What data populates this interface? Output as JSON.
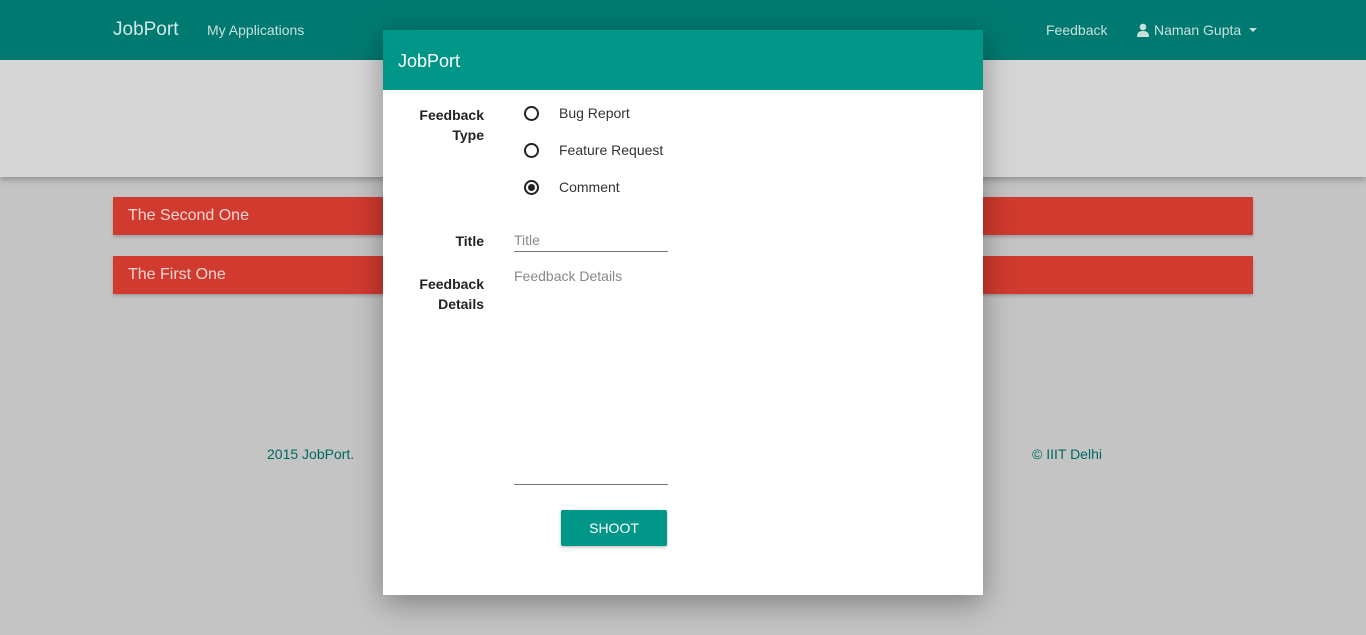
{
  "navbar": {
    "brand": "JobPort",
    "my_applications": "My Applications",
    "feedback": "Feedback",
    "user_name": "Naman Gupta"
  },
  "cards": [
    {
      "title": "The Second One"
    },
    {
      "title": "The First One"
    }
  ],
  "footer": {
    "left": "2015 JobPort.",
    "right": "© IIIT Delhi"
  },
  "modal": {
    "title": "JobPort",
    "feedback_type_label": "Feedback Type",
    "options": [
      {
        "label": "Bug Report",
        "checked": false
      },
      {
        "label": "Feature Request",
        "checked": false
      },
      {
        "label": "Comment",
        "checked": true
      }
    ],
    "title_label": "Title",
    "title_placeholder": "Title",
    "title_value": "",
    "details_label": "Feedback Details",
    "details_placeholder": "Feedback Details",
    "details_value": "",
    "submit_label": "SHOOT"
  },
  "colors": {
    "primary": "#009688",
    "navbar": "#007a70",
    "card": "#d13a2f"
  }
}
